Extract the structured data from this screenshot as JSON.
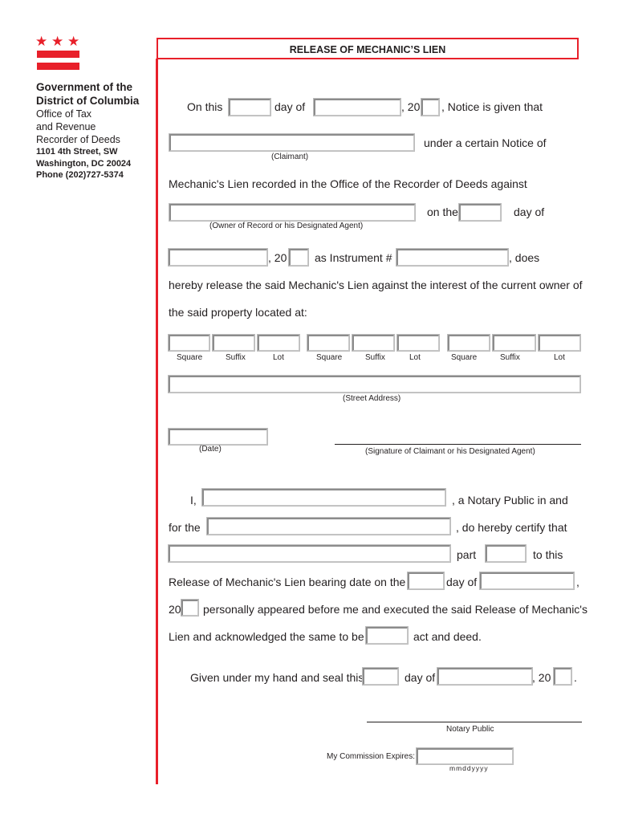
{
  "sidebar": {
    "logo_icon": "dc-flag-stars-and-bars",
    "org_line1": "Government of the",
    "org_line2": "District of Columbia",
    "office_line1": "Office of Tax",
    "office_line2": "and Revenue",
    "office_line3": "Recorder of Deeds",
    "address_line1": "1101 4th Street, SW",
    "address_line2": "Washington, DC 20024",
    "phone": "Phone (202)727-5374"
  },
  "form": {
    "title": "RELEASE OF MECHANIC’S LIEN",
    "line1": {
      "on_this": "On this",
      "day_of": "day of",
      "comma_20": ", 20",
      "notice": ", Notice is given that"
    },
    "line2": {
      "under": "under a certain Notice of",
      "claimant_caption": "(Claimant)"
    },
    "line3": {
      "text": "Mechanic's Lien recorded in the Office of the Recorder of Deeds against"
    },
    "line4": {
      "on_the": "on the",
      "day_of": "day of",
      "owner_caption": "(Owner of Record or his Designated  Agent)"
    },
    "line5": {
      "comma_20": ", 20",
      "as_instrument": "as Instrument #",
      "does": ", does"
    },
    "line6": {
      "text": "hereby release the said Mechanic's Lien against the interest of the current owner of"
    },
    "line7": {
      "text": "the said property located at:"
    },
    "ssl_captions": [
      "Square",
      "Suffix",
      "Lot",
      "Square",
      "Suffix",
      "Lot",
      "Square",
      "Suffix",
      "Lot"
    ],
    "street_caption": "(Street Address)",
    "date_caption": "(Date)",
    "signature_caption": "(Signature of Claimant or his Designated  Agent)",
    "notary": {
      "i": "I,",
      "notary_public_in_and": ",  a Notary Public in and",
      "for_the": "for the",
      "certify": ", do hereby certify that",
      "part": "part",
      "to_this": "to this",
      "release_bearing": "Release of Mechanic's Lien bearing date on the",
      "day_of": "day of",
      "comma": ",",
      "twenty": "20",
      "personally": "personally appeared before me and executed the said Release of Mechanic's",
      "lien_ack": "Lien and acknowledged the same to be",
      "act_deed": "act and deed.",
      "given": "Given under my hand and seal this",
      "day_of2": "day of",
      "comma_20": ", 20",
      "period": ".",
      "notary_public_caption": "Notary Public",
      "commission_label": "My Commission Expires:",
      "commission_format": "mmddyyyy"
    },
    "fields": {
      "notice_day": "",
      "notice_month": "",
      "notice_year": "",
      "claimant": "",
      "owner": "",
      "lien_day": "",
      "lien_month": "",
      "lien_year": "",
      "instrument_number": "",
      "ssl": [
        "",
        "",
        "",
        "",
        "",
        "",
        "",
        "",
        ""
      ],
      "street_address": "",
      "date": "",
      "notary_name": "",
      "jurisdiction": "",
      "party_name": "",
      "part": "",
      "release_day": "",
      "release_month": "",
      "release_year": "",
      "act_of": "",
      "seal_day": "",
      "seal_month": "",
      "seal_year": "",
      "commission_expires": ""
    }
  }
}
